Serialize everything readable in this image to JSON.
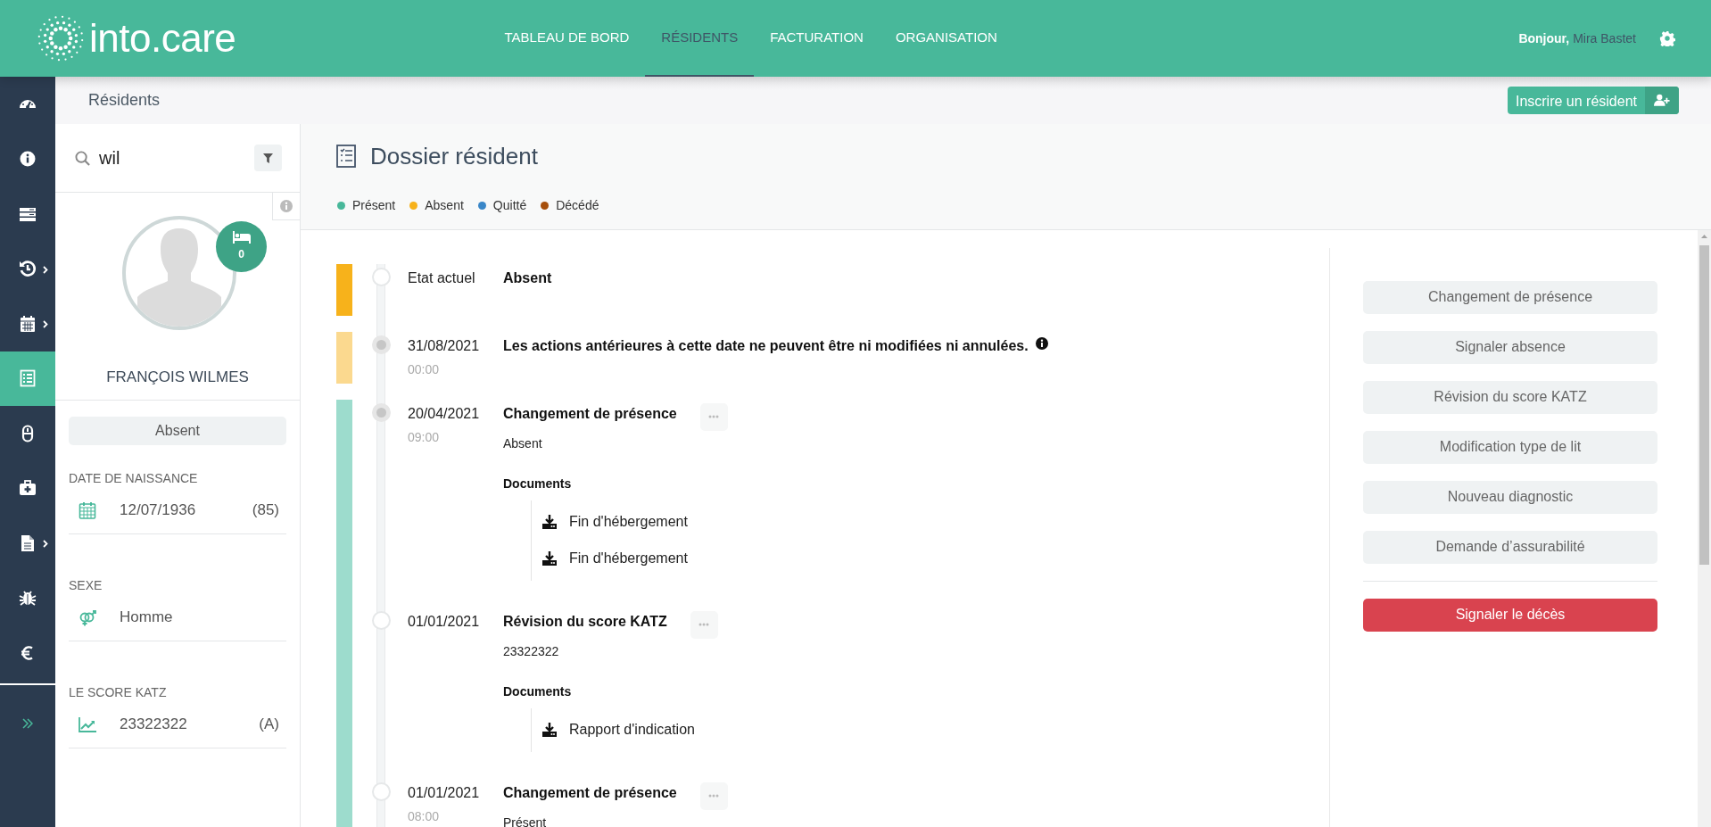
{
  "app": {
    "logo_text": "into.care"
  },
  "nav": [
    {
      "label": "TABLEAU DE BORD",
      "selected": false
    },
    {
      "label": "RÉSIDENTS",
      "selected": true
    },
    {
      "label": "FACTURATION",
      "selected": false
    },
    {
      "label": "ORGANISATION",
      "selected": false
    }
  ],
  "greeting": {
    "prefix": "Bonjour,",
    "user": "Mira Bastet"
  },
  "rail": [
    {
      "kind": "gauge",
      "selected": false,
      "submenu": false
    },
    {
      "kind": "info",
      "selected": false,
      "submenu": false
    },
    {
      "kind": "server",
      "selected": false,
      "submenu": false
    },
    {
      "kind": "history",
      "selected": false,
      "submenu": true
    },
    {
      "kind": "calendar",
      "selected": false,
      "submenu": true
    },
    {
      "kind": "checklist",
      "selected": true,
      "submenu": false
    },
    {
      "kind": "pill",
      "selected": false,
      "submenu": false
    },
    {
      "kind": "medkit",
      "selected": false,
      "submenu": false
    },
    {
      "kind": "document",
      "selected": false,
      "submenu": true
    },
    {
      "kind": "bug",
      "selected": false,
      "submenu": false
    },
    {
      "kind": "euro",
      "selected": false,
      "submenu": false
    }
  ],
  "breadcrumb": "Résidents",
  "register_button": "Inscrire un résident",
  "search": {
    "value": "wil"
  },
  "resident": {
    "name": "FRANÇOIS WILMES",
    "bed_count": "0",
    "status": "Absent",
    "fields": [
      {
        "kind": "birthdate",
        "label": "DATE DE NAISSANCE",
        "value": "12/07/1936",
        "extra": "(85)"
      },
      {
        "kind": "sex",
        "label": "SEXE",
        "value": "Homme"
      },
      {
        "kind": "katz",
        "label": "LE SCORE KATZ",
        "value": "23322322",
        "extra": "(A)"
      }
    ]
  },
  "dossier": {
    "title": "Dossier résident",
    "legend": [
      {
        "label": "Présent",
        "color": "#48b89a"
      },
      {
        "label": "Absent",
        "color": "#f7b21b"
      },
      {
        "label": "Quitté",
        "color": "#3a87c8"
      },
      {
        "label": "Décédé",
        "color": "#a64f0c"
      }
    ]
  },
  "timeline": [
    {
      "date": "Etat actuel",
      "title": "Absent",
      "color": "#f7b21b",
      "filled": false,
      "info": false,
      "menu": false
    },
    {
      "date": "31/08/2021",
      "time": "00:00",
      "title": "Les actions antérieures à cette date ne peuvent être ni modifiées ni annulées.",
      "color": "#fbd98f",
      "filled": true,
      "info": true,
      "menu": false
    },
    {
      "date": "20/04/2021",
      "time": "09:00",
      "title": "Changement de présence",
      "detail": "Absent",
      "documents_label": "Documents",
      "documents": [
        "Fin d'hébergement",
        "Fin d'hébergement"
      ],
      "color": "#9ddccd",
      "filled": true,
      "info": false,
      "menu": true
    },
    {
      "date": "01/01/2021",
      "title": "Révision du score KATZ",
      "detail": "23322322",
      "documents_label": "Documents",
      "documents": [
        "Rapport d'indication"
      ],
      "color": "#9ddccd",
      "filled": false,
      "info": false,
      "menu": true
    },
    {
      "date": "01/01/2021",
      "time": "08:00",
      "title": "Changement de présence",
      "detail": "Présent",
      "color": "#9ddccd",
      "filled": false,
      "info": false,
      "menu": true
    }
  ],
  "actions": [
    {
      "label": "Changement de présence",
      "kind": "default"
    },
    {
      "label": "Signaler absence",
      "kind": "default"
    },
    {
      "label": "Révision du score KATZ",
      "kind": "default"
    },
    {
      "label": "Modification type de lit",
      "kind": "default"
    },
    {
      "label": "Nouveau diagnostic",
      "kind": "default"
    },
    {
      "label": "Demande d’assurabilité",
      "kind": "default"
    },
    {
      "label": "Signaler le décès",
      "kind": "danger"
    }
  ]
}
